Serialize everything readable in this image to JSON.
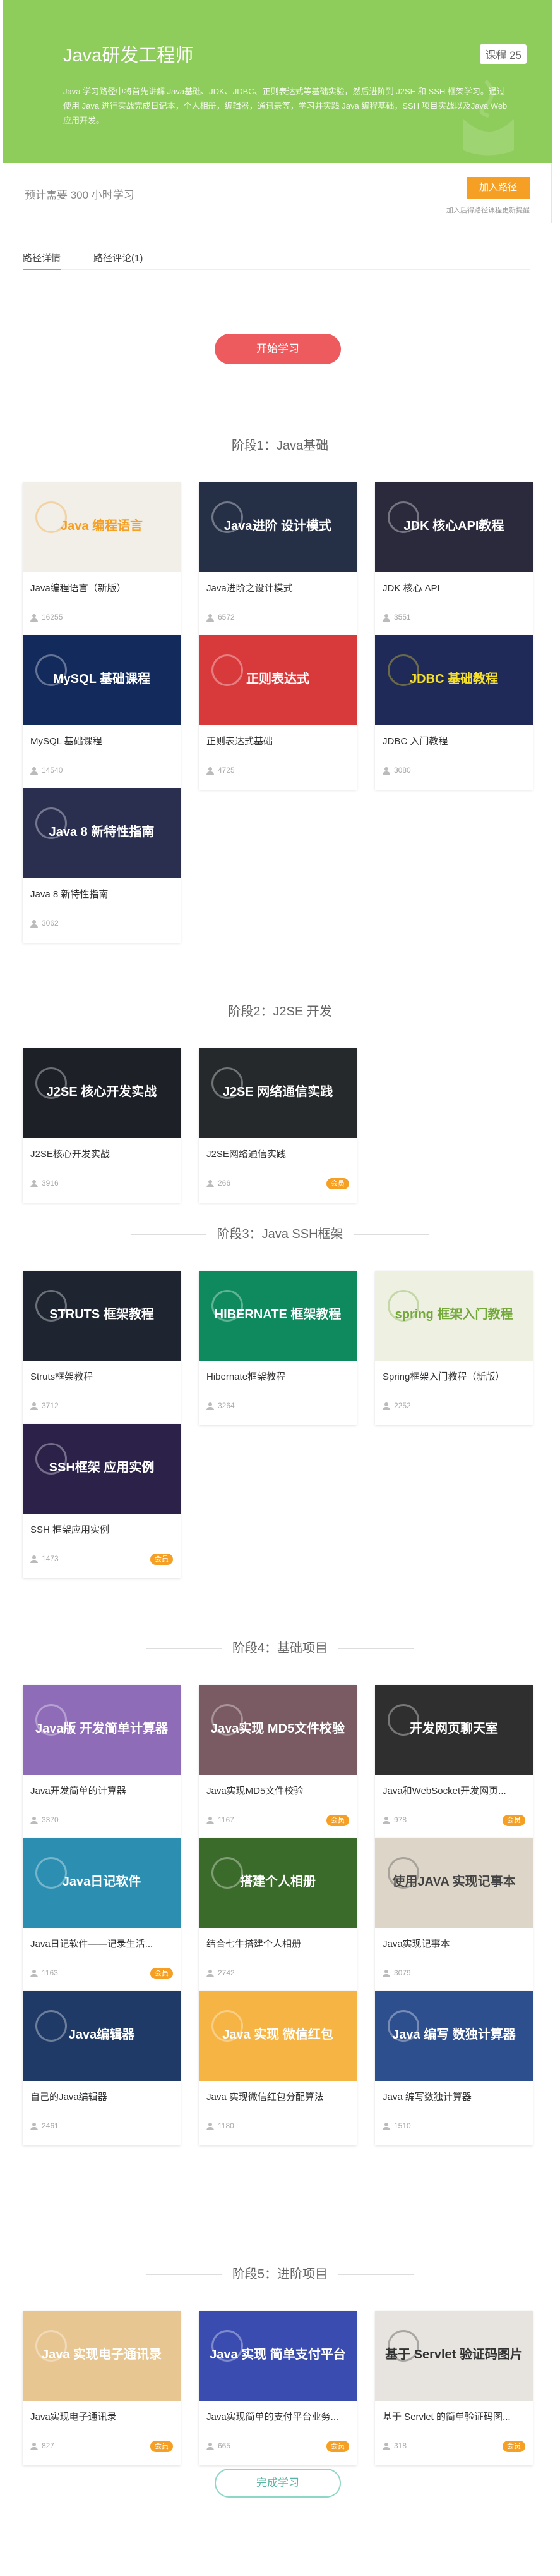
{
  "header": {
    "title": "Java研发工程师",
    "course_count": "课程 25",
    "description": "Java 学习路径中将首先讲解 Java基础、JDK、JDBC、正则表达式等基础实验，然后进阶到 J2SE 和 SSH 框架学习。通过使用 Java 进行实战完成日记本，个人相册，编辑器，通讯录等，学习并实践 Java 编程基础，SSH 项目实战以及Java Web 应用开发。"
  },
  "plan": {
    "text": "预计需要 300 小时学习",
    "join_label": "加入路径",
    "join_note": "加入后得路径课程更新提醒"
  },
  "tabs": [
    {
      "label": "路径详情",
      "active": true
    },
    {
      "label": "路径评论(1)",
      "active": false
    }
  ],
  "start_label": "开始学习",
  "finish_label": "完成学习",
  "vip_label": "会员",
  "stages": [
    {
      "title": "阶段1：Java基础",
      "courses": [
        {
          "name": "Java编程语言（新版）",
          "count": "16255",
          "vip": false,
          "bg": "#f1efe8",
          "fg": "#f5a024",
          "thumb_text": "Java 编程语言",
          "icon": "java-cup-icon"
        },
        {
          "name": "Java进阶之设计模式",
          "count": "6572",
          "vip": false,
          "bg": "#253047",
          "fg": "#ffffff",
          "thumb_text": "Java进阶 设计模式",
          "icon": "bird-icon"
        },
        {
          "name": "JDK 核心 API",
          "count": "3551",
          "vip": false,
          "bg": "#2b2a3c",
          "fg": "#ffffff",
          "thumb_text": "JDK 核心API教程",
          "icon": "java-cup-icon"
        },
        {
          "name": "MySQL 基础课程",
          "count": "14540",
          "vip": false,
          "bg": "#132a5c",
          "fg": "#ffffff",
          "thumb_text": "MySQL 基础课程",
          "icon": "database-icon"
        },
        {
          "name": "正则表达式基础",
          "count": "4725",
          "vip": false,
          "bg": "#d83a3c",
          "fg": "#ffffff",
          "thumb_text": "正则表达式",
          "icon": "regex-icon"
        },
        {
          "name": "JDBC 入门教程",
          "count": "3080",
          "vip": false,
          "bg": "#1f2a58",
          "fg": "#f6e02a",
          "thumb_text": "JDBC 基础教程",
          "icon": "jdbc-icon"
        },
        {
          "name": "Java 8 新特性指南",
          "count": "3062",
          "vip": false,
          "bg": "#2a2f50",
          "fg": "#ffffff",
          "thumb_text": "Java 8 新特性指南",
          "icon": "rocket-icon"
        }
      ]
    },
    {
      "title": "阶段2：J2SE 开发",
      "courses": [
        {
          "name": "J2SE核心开发实战",
          "count": "3916",
          "vip": false,
          "bg": "#1d2027",
          "fg": "#ffffff",
          "thumb_text": "J2SE 核心开发实战",
          "icon": "java-cup-icon"
        },
        {
          "name": "J2SE网络通信实践",
          "count": "266",
          "vip": true,
          "bg": "#25292b",
          "fg": "#ffffff",
          "thumb_text": "J2SE 网络通信实践",
          "icon": "java-cup-icon"
        }
      ]
    },
    {
      "title": "阶段3：Java SSH框架",
      "courses": [
        {
          "name": "Struts框架教程",
          "count": "3712",
          "vip": false,
          "bg": "#1e2430",
          "fg": "#ffffff",
          "thumb_text": "STRUTS 框架教程",
          "icon": "struts-icon"
        },
        {
          "name": "Hibernate框架教程",
          "count": "3264",
          "vip": false,
          "bg": "#0f8a5e",
          "fg": "#ffffff",
          "thumb_text": "HIBERNATE 框架教程",
          "icon": "hibernate-icon"
        },
        {
          "name": "Spring框架入门教程（新版）",
          "count": "2252",
          "vip": false,
          "bg": "#eef0e2",
          "fg": "#73a839",
          "thumb_text": "spring 框架入门教程",
          "icon": "spring-leaf-icon"
        },
        {
          "name": "SSH 框架应用实例",
          "count": "1473",
          "vip": true,
          "bg": "#2b2149",
          "fg": "#ffffff",
          "thumb_text": "SSH框架 应用实例",
          "icon": "ssh-icon"
        }
      ]
    },
    {
      "title": "阶段4：基础项目",
      "courses": [
        {
          "name": "Java开发简单的计算器",
          "count": "3370",
          "vip": false,
          "bg": "#8f6cb8",
          "fg": "#ffffff",
          "thumb_text": "Java版 开发简单计算器",
          "icon": "calculator-icon"
        },
        {
          "name": "Java实现MD5文件校验",
          "count": "1167",
          "vip": true,
          "bg": "#7a5a63",
          "fg": "#ffffff",
          "thumb_text": "Java实现 MD5文件校验",
          "icon": "lock-icon"
        },
        {
          "name": "Java和WebSocket开发网页...",
          "count": "978",
          "vip": true,
          "bg": "#2f2f2f",
          "fg": "#ffffff",
          "thumb_text": "开发网页聊天室",
          "icon": "html5-icon"
        },
        {
          "name": "Java日记软件——记录生活...",
          "count": "1163",
          "vip": true,
          "bg": "#2c8fb2",
          "fg": "#ffffff",
          "thumb_text": "Java日记软件",
          "icon": "notebook-icon"
        },
        {
          "name": "结合七牛搭建个人相册",
          "count": "2742",
          "vip": false,
          "bg": "#3b6b2a",
          "fg": "#ffffff",
          "thumb_text": "搭建个人相册",
          "icon": "photo-icon"
        },
        {
          "name": "Java实现记事本",
          "count": "3079",
          "vip": false,
          "bg": "#ddd6c8",
          "fg": "#444444",
          "thumb_text": "使用JAVA 实现记事本",
          "icon": "notepad-icon"
        },
        {
          "name": "自己的Java编辑器",
          "count": "2461",
          "vip": false,
          "bg": "#1f3a66",
          "fg": "#ffffff",
          "thumb_text": "Java编辑器",
          "icon": "editor-icon"
        },
        {
          "name": "Java 实现微信红包分配算法",
          "count": "1180",
          "vip": false,
          "bg": "#f6b445",
          "fg": "#ffffff",
          "thumb_text": "Java 实现 微信红包",
          "icon": "redpacket-icon"
        },
        {
          "name": "Java 编写数独计算器",
          "count": "1510",
          "vip": false,
          "bg": "#2e4f8e",
          "fg": "#ffffff",
          "thumb_text": "Java 编写 数独计算器",
          "icon": "sudoku-icon"
        }
      ]
    },
    {
      "title": "阶段5：进阶项目",
      "courses": [
        {
          "name": "Java实现电子通讯录",
          "count": "827",
          "vip": true,
          "bg": "#e8c692",
          "fg": "#ffffff",
          "thumb_text": "Java 实现电子通讯录",
          "icon": "phone-icon"
        },
        {
          "name": "Java实现简单的支付平台业务...",
          "count": "665",
          "vip": true,
          "bg": "#3b4cb0",
          "fg": "#ffffff",
          "thumb_text": "Java 实现 简单支付平台",
          "icon": "wallet-icon"
        },
        {
          "name": "基于 Servlet 的简单验证码图...",
          "count": "318",
          "vip": true,
          "bg": "#e7e3df",
          "fg": "#333333",
          "thumb_text": "基于 Servlet 验证码图片",
          "icon": "printer-icon"
        }
      ]
    }
  ]
}
